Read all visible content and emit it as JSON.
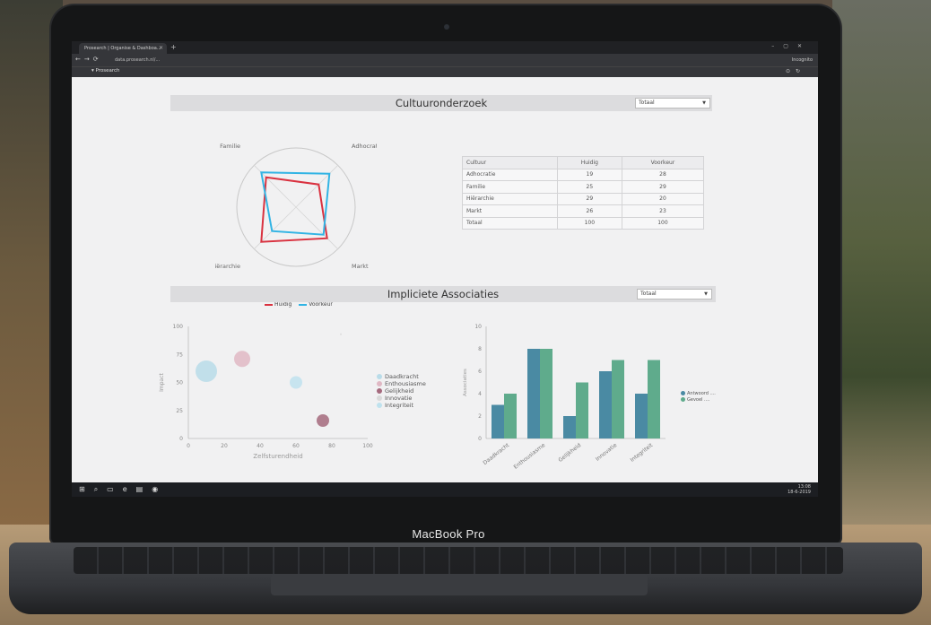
{
  "device": {
    "brand": "MacBook Pro"
  },
  "browser": {
    "tab_title": "Prosearch | Organise & Dashboa...",
    "url": "data.prosearch.nl/...",
    "profile_label": "Incognito",
    "bookmark": "Prosearch"
  },
  "sections": [
    {
      "title": "Cultuuronderzoek",
      "select_value": "Totaal"
    },
    {
      "title": "Impliciete Associaties",
      "select_value": "Totaal"
    }
  ],
  "culture_table": {
    "headers": [
      "Cultuur",
      "Huidig",
      "Voorkeur"
    ],
    "rows": [
      [
        "Adhocratie",
        "19",
        "28"
      ],
      [
        "Familie",
        "25",
        "29"
      ],
      [
        "Hiërarchie",
        "29",
        "20"
      ],
      [
        "Markt",
        "26",
        "23"
      ]
    ],
    "total": [
      "Totaal",
      "100",
      "100"
    ]
  },
  "chart_data": [
    {
      "type": "radar",
      "categories": [
        "Familie",
        "Adhocratie",
        "Markt",
        "Hiërarchie"
      ],
      "series": [
        {
          "name": "Huidig",
          "values": [
            25,
            19,
            26,
            29
          ],
          "color": "#d93240"
        },
        {
          "name": "Voorkeur",
          "values": [
            29,
            28,
            23,
            20
          ],
          "color": "#32b4e4"
        }
      ],
      "legend": "bottom"
    },
    {
      "type": "scatter",
      "xlabel": "Zelfsturendheid",
      "ylabel": "Impact",
      "xlim": [
        0,
        100
      ],
      "ylim": [
        0,
        100
      ],
      "xticks": [
        "0",
        "20",
        "40",
        "60",
        "80",
        "100"
      ],
      "yticks": [
        "0",
        "25",
        "50",
        "75",
        "100"
      ],
      "series": [
        {
          "name": "Daadkracht",
          "x": 10,
          "y": 60,
          "size": 12,
          "color": "#b9dce9"
        },
        {
          "name": "Enthousiasme",
          "x": 30,
          "y": 71,
          "size": 9,
          "color": "#e0b8c4"
        },
        {
          "name": "Gelijkheid",
          "x": 75,
          "y": 16,
          "size": 7,
          "color": "#a56a7d"
        },
        {
          "name": "Innovatie",
          "x": 85,
          "y": 93,
          "size": 1,
          "color": "#d9d9d9"
        },
        {
          "name": "Integriteit",
          "x": 60,
          "y": 50,
          "size": 7,
          "color": "#bfe2ee"
        }
      ],
      "legend": "right"
    },
    {
      "type": "bar",
      "xlabel": "",
      "ylabel": "Associaties",
      "categories": [
        "Daadkracht",
        "Enthousiasme",
        "Gelijkheid",
        "Innovatie",
        "Integriteit"
      ],
      "ylim": [
        0,
        10
      ],
      "yticks": [
        "0",
        "2",
        "4",
        "6",
        "8",
        "10"
      ],
      "series": [
        {
          "name": "Antwoord ....",
          "values": [
            3,
            8,
            2,
            6,
            4
          ],
          "color": "#4a8aa3"
        },
        {
          "name": "Gevoel ....",
          "values": [
            4,
            8,
            5,
            7,
            7
          ],
          "color": "#5fab8c"
        }
      ],
      "legend": "right"
    }
  ],
  "taskbar": {
    "time": "13:08",
    "date": "18-6-2019"
  }
}
